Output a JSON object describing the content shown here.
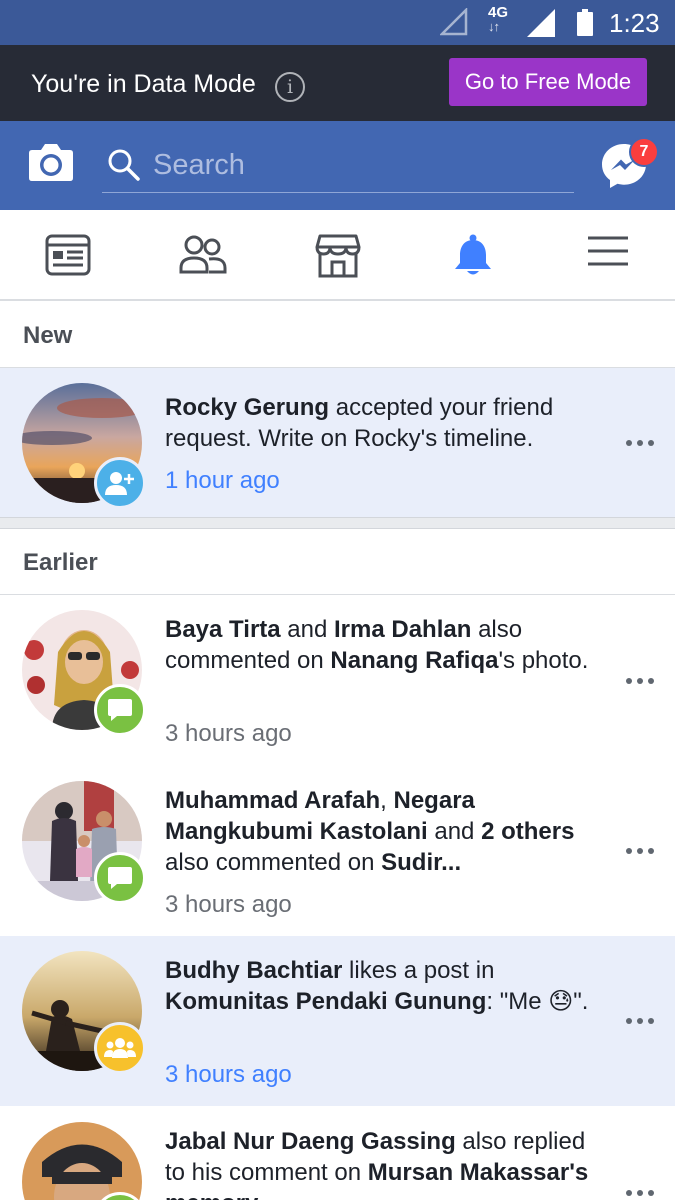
{
  "status_bar": {
    "network": "4G",
    "network_arrows": "↓↑",
    "time": "1:23"
  },
  "data_banner": {
    "message": "You're in Data Mode",
    "info_glyph": "i",
    "button_label": "Go to Free Mode"
  },
  "header": {
    "search_placeholder": "Search",
    "messenger_count": "7"
  },
  "tabs": [
    {
      "name": "news-feed",
      "icon": "news-feed-icon",
      "active": false
    },
    {
      "name": "friend-requests",
      "icon": "friends-icon",
      "active": false
    },
    {
      "name": "marketplace",
      "icon": "marketplace-icon",
      "active": false
    },
    {
      "name": "notifications",
      "icon": "bell-icon",
      "active": true
    },
    {
      "name": "menu",
      "icon": "hamburger-menu-icon",
      "active": false
    }
  ],
  "sections": {
    "new_label": "New",
    "earlier_label": "Earlier"
  },
  "notifications": [
    {
      "parts": [
        {
          "t": "Rocky Gerung",
          "b": true
        },
        {
          "t": " accepted your friend request. Write on Rocky's timeline.",
          "b": false
        }
      ],
      "time": "1 hour ago",
      "badge": "friend-accept-icon",
      "unread": true
    },
    {
      "parts": [
        {
          "t": "Baya Tirta",
          "b": true
        },
        {
          "t": " and ",
          "b": false
        },
        {
          "t": "Irma Dahlan",
          "b": true
        },
        {
          "t": " also commented on ",
          "b": false
        },
        {
          "t": "Nanang Rafiqa",
          "b": true
        },
        {
          "t": "'s photo.",
          "b": false
        }
      ],
      "time": "3 hours ago",
      "badge": "comment-icon",
      "unread": false
    },
    {
      "parts": [
        {
          "t": "Muhammad Arafah",
          "b": true
        },
        {
          "t": ", ",
          "b": false
        },
        {
          "t": "Negara Mangkubumi Kastolani",
          "b": true
        },
        {
          "t": " and ",
          "b": false
        },
        {
          "t": "2 others",
          "b": true
        },
        {
          "t": " also commented on ",
          "b": false
        },
        {
          "t": "Sudir...",
          "b": true
        }
      ],
      "time": "3 hours ago",
      "badge": "comment-icon",
      "unread": false
    },
    {
      "parts": [
        {
          "t": "Budhy Bachtiar",
          "b": true
        },
        {
          "t": " likes a post in ",
          "b": false
        },
        {
          "t": "Komunitas Pendaki Gunung",
          "b": true
        },
        {
          "t": ": \"Me 😓\".",
          "b": false
        }
      ],
      "time": "3 hours ago",
      "badge": "group-icon",
      "unread": true
    },
    {
      "parts": [
        {
          "t": "Jabal Nur Daeng Gassing",
          "b": true
        },
        {
          "t": " also replied to his comment on ",
          "b": false
        },
        {
          "t": "Mursan Makassar's memory",
          "b": true
        }
      ],
      "time": "",
      "badge": "comment-icon",
      "unread": false
    }
  ],
  "colors": {
    "brand_blue": "#4267b2",
    "status_bar": "#3b5998",
    "banner": "#272b36",
    "free_mode_button": "#9a35c8",
    "unread_bg": "#e9eefa",
    "comment_badge": "#7ac142",
    "friend_badge": "#4cb0e8",
    "group_badge": "#f7c12c",
    "link_blue": "#4080ff"
  }
}
